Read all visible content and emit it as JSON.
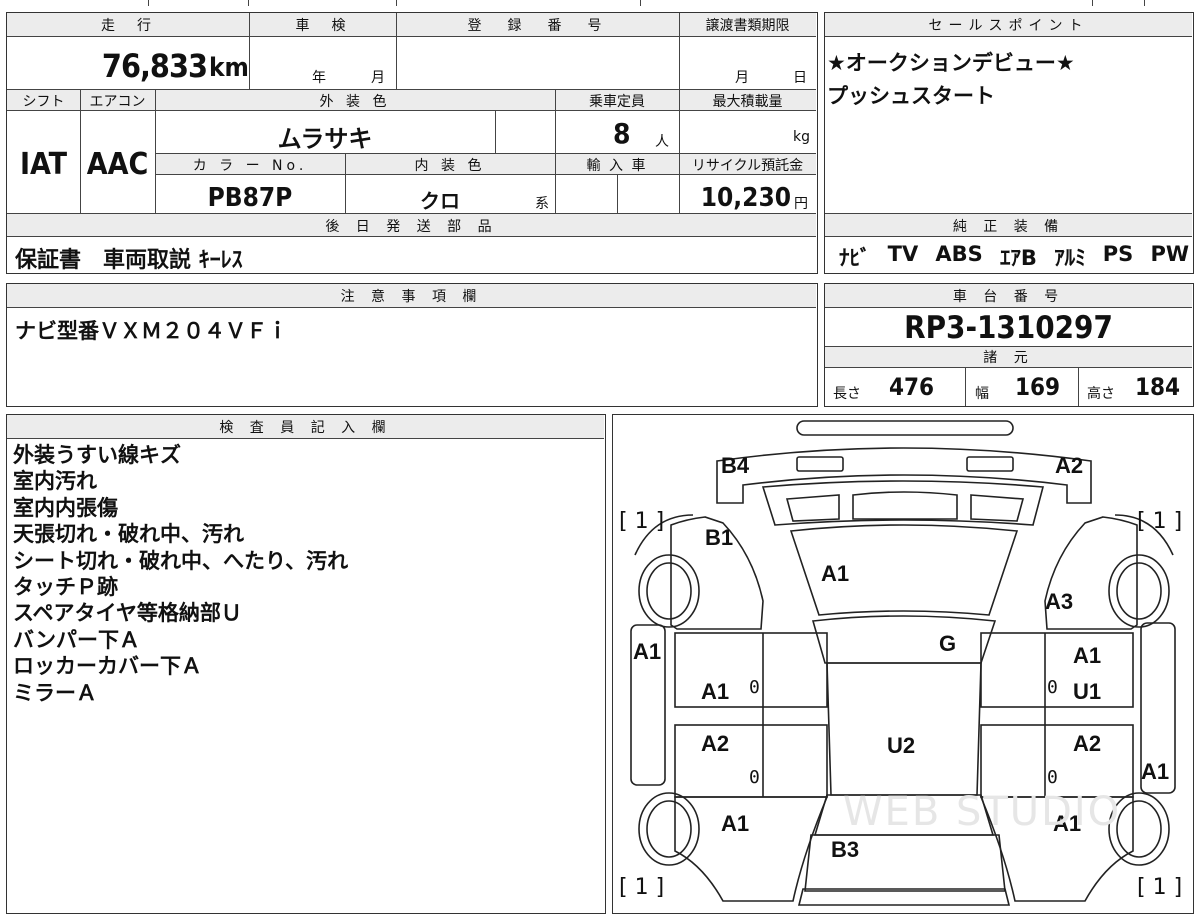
{
  "top": {
    "mileage_header": "走　行",
    "mileage_value": "76,833",
    "mileage_unit": "km",
    "inspection_header": "車　検",
    "inspection_year": "年",
    "inspection_month": "月",
    "registration_header": "登　録　番　号",
    "transfer_header": "譲渡書類期限",
    "transfer_month": "月",
    "transfer_day": "日"
  },
  "row2": {
    "shift_header": "シフト",
    "ac_header": "エアコン",
    "exterior_header": "外 装 色",
    "capacity_header": "乗車定員",
    "load_header": "最大積載量",
    "shift_value": "IAT",
    "ac_value": "AAC",
    "exterior_value": "ムラサキ",
    "capacity_value": "8",
    "capacity_unit": "人",
    "load_unit": "kg",
    "color_no_header": "カ ラ ー No.",
    "interior_header": "内 装 色",
    "import_header": "輸 入 車",
    "recycle_header": "リサイクル預託金",
    "color_no_value": "PB87P",
    "interior_value": "クロ",
    "interior_suffix": "系",
    "recycle_value": "10,230",
    "recycle_unit": "円"
  },
  "parts": {
    "header": "後 日 発 送 部 品",
    "value": "保証書　車両取説 ｷｰﾚｽ"
  },
  "sales": {
    "header": "セールスポイント",
    "lines": [
      "★オークションデビュー★",
      "プッシュスタート"
    ]
  },
  "equipment": {
    "header": "純 正 装 備",
    "items": [
      "ﾅﾋﾞ",
      "TV",
      "ABS",
      "ｴｱB",
      "ｱﾙﾐ",
      "PS",
      "PW"
    ]
  },
  "notes": {
    "header": "注 意 事 項 欄",
    "value": "ナビ型番ＶＸＭ２０４ＶＦｉ"
  },
  "chassis": {
    "header": "車 台 番 号",
    "value": "RP3-1310297",
    "spec_header": "諸 元",
    "length_label": "長さ",
    "length_value": "476",
    "width_label": "幅",
    "width_value": "169",
    "height_label": "高さ",
    "height_value": "184"
  },
  "inspector": {
    "header": "検 査 員 記 入 欄",
    "lines": [
      "外装うすい線キズ",
      "室内汚れ",
      "室内内張傷",
      "天張切れ・破れ中、汚れ",
      "シート切れ・破れ中、へたり、汚れ",
      "タッチＰ跡",
      "スペアタイヤ等格納部Ｕ",
      "バンパー下Ａ",
      "ロッカーカバー下Ａ",
      "ミラーＡ"
    ]
  },
  "diagram": {
    "labels": {
      "b4": "B4",
      "a2_top": "A2",
      "b1": "B1",
      "a1_hood": "A1",
      "a3": "A3",
      "g": "G",
      "a1_left": "A1",
      "a1_right": "A1",
      "a1_door_l": "A1",
      "u1": "U1",
      "u2": "U2",
      "a2_door_l": "A2",
      "a2_door_r": "A2",
      "a1_side_r": "A1",
      "a1_rear_l": "A1",
      "a1_rear_r": "A1",
      "b3": "B3"
    },
    "brackets": {
      "tl": "[ 1 ]",
      "tr": "[ 1 ]",
      "bl": "[ 1 ]",
      "br": "[ 1 ]"
    },
    "zeros": [
      "0",
      "0",
      "0",
      "0"
    ],
    "watermark": "WEB STUDIO"
  }
}
